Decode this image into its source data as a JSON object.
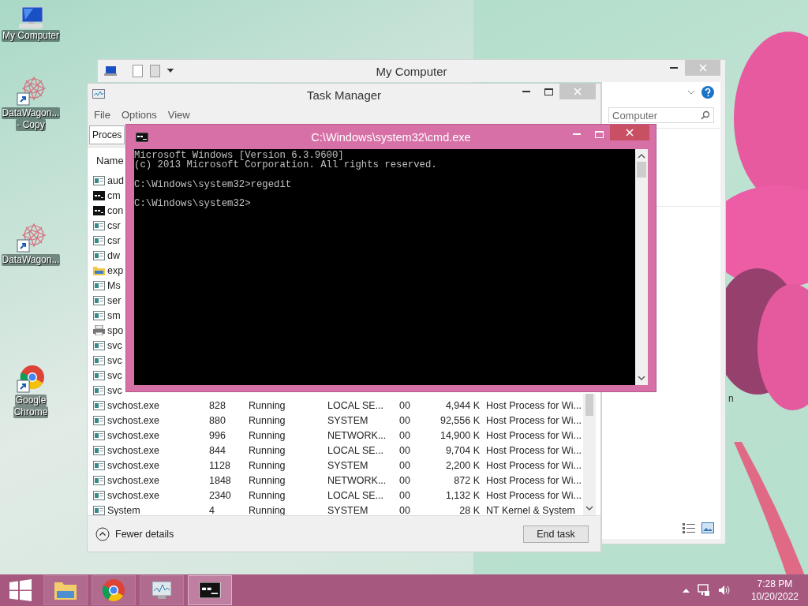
{
  "desktop_icons": [
    {
      "kind": "computer",
      "lines": [
        "My Computer"
      ]
    },
    {
      "kind": "shortcut",
      "lines": [
        "DataWagon...",
        "- Copy"
      ]
    },
    {
      "kind": "shortcut",
      "lines": [
        "DataWagon..."
      ]
    },
    {
      "kind": "chrome",
      "lines": [
        "Google",
        "Chrome"
      ]
    }
  ],
  "hidden_icon_label": "n",
  "explorer": {
    "title": "My Computer",
    "search": {
      "placeholder": "Computer"
    }
  },
  "task_manager": {
    "title": "Task Manager",
    "menu": [
      "File",
      "Options",
      "View"
    ],
    "tabs": [
      {
        "label": "Proces",
        "selected": true
      }
    ],
    "columns": [
      {
        "label": "Name"
      }
    ],
    "rows": [
      {
        "kind": "service",
        "cells": [
          "aud"
        ]
      },
      {
        "kind": "console",
        "cells": [
          "cm"
        ]
      },
      {
        "kind": "console",
        "cells": [
          "con"
        ]
      },
      {
        "kind": "service",
        "cells": [
          "csr"
        ]
      },
      {
        "kind": "service",
        "cells": [
          "csr"
        ]
      },
      {
        "kind": "service",
        "cells": [
          "dw"
        ]
      },
      {
        "kind": "folder",
        "cells": [
          "exp"
        ]
      },
      {
        "kind": "service",
        "cells": [
          "Ms"
        ]
      },
      {
        "kind": "service",
        "cells": [
          "ser"
        ]
      },
      {
        "kind": "service",
        "cells": [
          "sm"
        ]
      },
      {
        "kind": "printer",
        "cells": [
          "spo"
        ]
      },
      {
        "kind": "service",
        "cells": [
          "svc"
        ]
      },
      {
        "kind": "service",
        "cells": [
          "svc"
        ]
      },
      {
        "kind": "service",
        "cells": [
          "svc"
        ]
      },
      {
        "kind": "service",
        "cells": [
          "svc"
        ]
      },
      {
        "kind": "service",
        "cells": [
          "svchost.exe",
          "828",
          "Running",
          "LOCAL SE...",
          "00",
          "4,944 K",
          "Host Process for Wi..."
        ]
      },
      {
        "kind": "service",
        "cells": [
          "svchost.exe",
          "880",
          "Running",
          "SYSTEM",
          "00",
          "92,556 K",
          "Host Process for Wi..."
        ]
      },
      {
        "kind": "service",
        "cells": [
          "svchost.exe",
          "996",
          "Running",
          "NETWORK...",
          "00",
          "14,900 K",
          "Host Process for Wi..."
        ]
      },
      {
        "kind": "service",
        "cells": [
          "svchost.exe",
          "844",
          "Running",
          "LOCAL SE...",
          "00",
          "9,704 K",
          "Host Process for Wi..."
        ]
      },
      {
        "kind": "service",
        "cells": [
          "svchost.exe",
          "1128",
          "Running",
          "SYSTEM",
          "00",
          "2,200 K",
          "Host Process for Wi..."
        ]
      },
      {
        "kind": "service",
        "cells": [
          "svchost.exe",
          "1848",
          "Running",
          "NETWORK...",
          "00",
          "872 K",
          "Host Process for Wi..."
        ]
      },
      {
        "kind": "service",
        "cells": [
          "svchost.exe",
          "2340",
          "Running",
          "LOCAL SE...",
          "00",
          "1,132 K",
          "Host Process for Wi..."
        ]
      },
      {
        "kind": "service",
        "cells": [
          "System",
          "4",
          "Running",
          "SYSTEM",
          "00",
          "28 K",
          "NT Kernel & System"
        ]
      }
    ],
    "footer": {
      "details_link": "Fewer details",
      "end_task": "End task"
    }
  },
  "cmd": {
    "title": "C:\\Windows\\system32\\cmd.exe",
    "blocks": [
      [
        "Microsoft Windows [Version 6.3.9600]",
        "(c) 2013 Microsoft Corporation. All rights reserved."
      ],
      [
        "C:\\Windows\\system32>regedit"
      ],
      [
        "C:\\Windows\\system32>"
      ]
    ]
  },
  "taskbar": {
    "apps": [
      {
        "kind": "explorer",
        "active": false
      },
      {
        "kind": "chrome",
        "active": false
      },
      {
        "kind": "taskmgr",
        "active": false
      },
      {
        "kind": "cmd",
        "active": true
      }
    ],
    "time": "7:28 PM",
    "date": "10/20/2022"
  }
}
